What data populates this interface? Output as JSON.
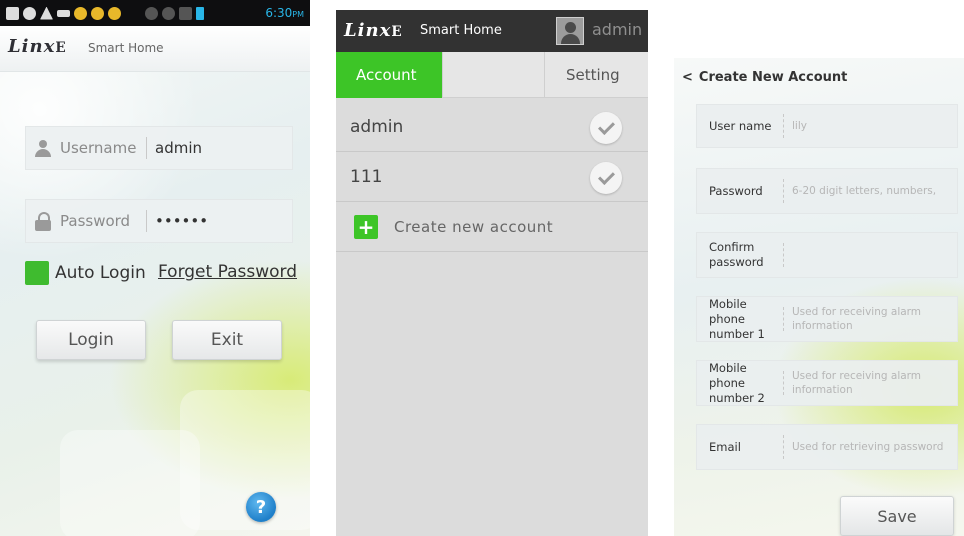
{
  "login": {
    "status_time": "6:30",
    "status_ampm": "PM",
    "logo": "Linx",
    "logo_mark": "E",
    "app_name": "Smart Home",
    "username_label": "Username",
    "username_value": "admin",
    "password_label": "Password",
    "password_value": "••••••",
    "auto_login_label": "Auto Login",
    "forget_password_label": "Forget Password",
    "login_button": "Login",
    "exit_button": "Exit",
    "help_glyph": "?",
    "colors": {
      "accent_green": "#3fbb2f",
      "help_blue": "#1f7fc9"
    }
  },
  "accounts": {
    "logo": "Linx",
    "logo_mark": "E",
    "app_name": "Smart Home",
    "current_user": "admin",
    "tabs": [
      {
        "label": "Account",
        "active": true
      },
      {
        "label": "Setting",
        "active": false
      }
    ],
    "list": [
      {
        "name": "admin"
      },
      {
        "name": "111"
      }
    ],
    "create_label": "Create new account",
    "plus_glyph": "+",
    "colors": {
      "header": "#323232",
      "accent_green": "#3dc527"
    }
  },
  "create_account": {
    "back_glyph": "<",
    "title": "Create New Account",
    "fields": [
      {
        "label": "User name",
        "placeholder": "lily"
      },
      {
        "label": "Password",
        "placeholder": "6-20 digit letters, numbers,"
      },
      {
        "label": "Confirm password",
        "placeholder": ""
      },
      {
        "label": "Mobile phone number 1",
        "placeholder": "Used for receiving alarm information"
      },
      {
        "label": "Mobile phone number 2",
        "placeholder": "Used for receiving alarm information"
      },
      {
        "label": "Email",
        "placeholder": "Used for retrieving password"
      }
    ],
    "save_button": "Save"
  }
}
